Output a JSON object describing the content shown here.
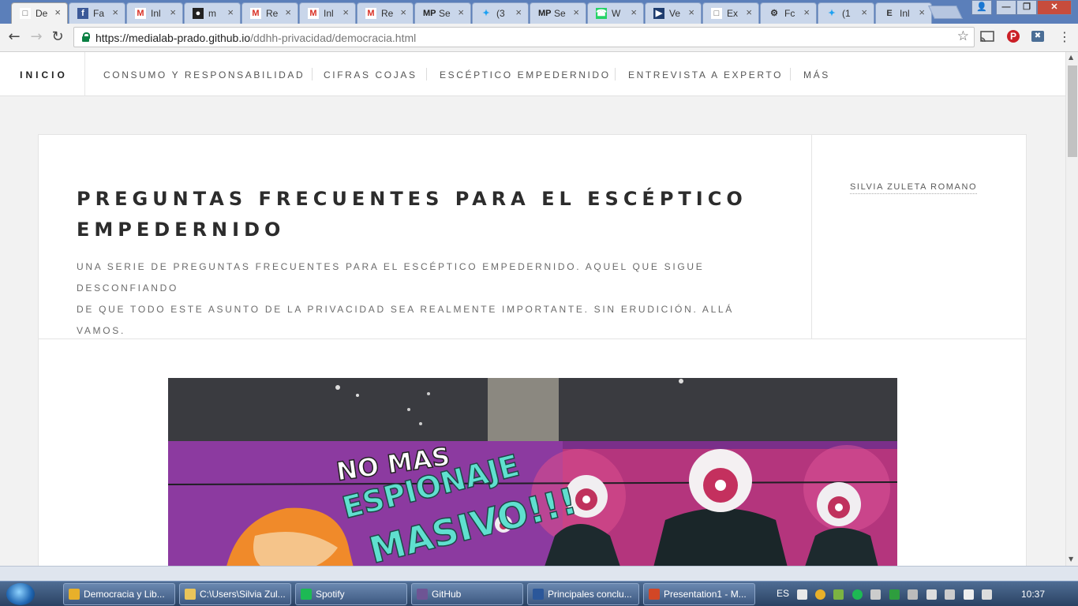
{
  "browser": {
    "tabs": [
      {
        "short": "De",
        "icon": "document-icon",
        "active": true
      },
      {
        "short": "Fa",
        "icon": "facebook-icon"
      },
      {
        "short": "Inl",
        "icon": "gmail-icon"
      },
      {
        "short": "m",
        "icon": "github-icon"
      },
      {
        "short": "Re",
        "icon": "gmail-icon"
      },
      {
        "short": "Inl",
        "icon": "gmail-icon"
      },
      {
        "short": "Re",
        "icon": "gmail-icon"
      },
      {
        "short": "Se",
        "icon": "medialab-prado-icon"
      },
      {
        "short": "(3",
        "icon": "twitter-icon"
      },
      {
        "short": "Se",
        "icon": "medialab-prado-icon"
      },
      {
        "short": "W",
        "icon": "whatsapp-icon"
      },
      {
        "short": "Ve",
        "icon": "video-icon"
      },
      {
        "short": "Ex",
        "icon": "document-icon"
      },
      {
        "short": "Fc",
        "icon": "settings-wheel-icon"
      },
      {
        "short": "(1",
        "icon": "twitter-icon"
      },
      {
        "short": "Inl",
        "icon": "epub-icon"
      }
    ],
    "url_host": "https://medialab-prado.github.io",
    "url_path": "/ddhh-privacidad/democracia.html"
  },
  "site": {
    "home": "INICIO",
    "nav": [
      "CONSUMO Y RESPONSABILIDAD",
      "CIFRAS COJAS",
      "ESCÉPTICO EMPEDERNIDO",
      "ENTREVISTA A EXPERTO",
      "MÁS"
    ],
    "title_line1": "PREGUNTAS FRECUENTES PARA EL ESCÉPTICO",
    "title_line2": "EMPEDERNIDO",
    "subtitle_line1": "UNA SERIE DE PREGUNTAS FRECUENTES PARA EL ESCÉPTICO EMPEDERNIDO. AQUEL QUE SIGUE DESCONFIANDO",
    "subtitle_line2": "DE QUE TODO ESTE ASUNTO DE LA PRIVACIDAD SEA REALMENTE IMPORTANTE. SIN ERUDICIÓN. ALLÁ VAMOS.",
    "author": "SILVIA ZULETA ROMANO",
    "hero_text_line1": "NO MAS",
    "hero_text_line2": "ESPIONAJE",
    "hero_text_line3": "MASIVO!!!"
  },
  "taskbar": {
    "items": [
      {
        "label": "Democracia y Lib...",
        "icon": "chrome-icon",
        "color": "#e8b02a"
      },
      {
        "label": "C:\\Users\\Silvia Zul...",
        "icon": "folder-icon",
        "color": "#e9c45a"
      },
      {
        "label": "Spotify",
        "icon": "spotify-icon",
        "color": "#1db954"
      },
      {
        "label": "GitHub",
        "icon": "github-desktop-icon",
        "color": "#6e5494"
      },
      {
        "label": "Principales conclu...",
        "icon": "word-icon",
        "color": "#2b579a"
      },
      {
        "label": "Presentation1 - M...",
        "icon": "powerpoint-icon",
        "color": "#d24726"
      }
    ],
    "lang": "ES",
    "clock": "10:37"
  }
}
